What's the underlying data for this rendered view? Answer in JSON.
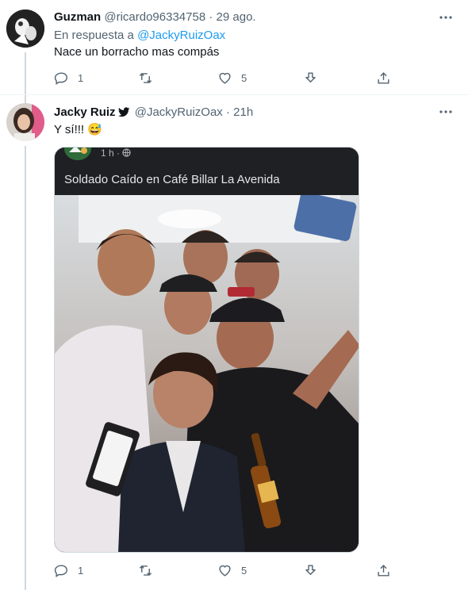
{
  "tweets": [
    {
      "name": "Guzman",
      "handle": "@ricardo96334758",
      "separator": "·",
      "time": "29 ago.",
      "reply_prefix": "En respuesta a",
      "reply_mention": "@JackyRuizOax",
      "text": "Nace un borracho mas compás",
      "replies": "1",
      "likes": "5"
    },
    {
      "name": "Jacky Ruiz",
      "handle": "@JackyRuizOax",
      "separator": "·",
      "time": "21h",
      "text": "Y sí!!! 😅",
      "replies": "1",
      "likes": "5",
      "media": {
        "meta": "1 h ·",
        "title": "Soldado Caído en Café Billar La Avenida"
      }
    }
  ],
  "icons": {
    "more": "more-dots-icon",
    "reply": "reply-icon",
    "retweet": "retweet-icon",
    "like": "heart-icon",
    "download": "download-icon",
    "share": "share-icon",
    "verified": "verified-bird-icon",
    "globe": "globe-icon"
  },
  "colors": {
    "text": "#0f1419",
    "secondary": "#536471",
    "link": "#1d9bf0",
    "thread_line": "#cfd9de"
  }
}
